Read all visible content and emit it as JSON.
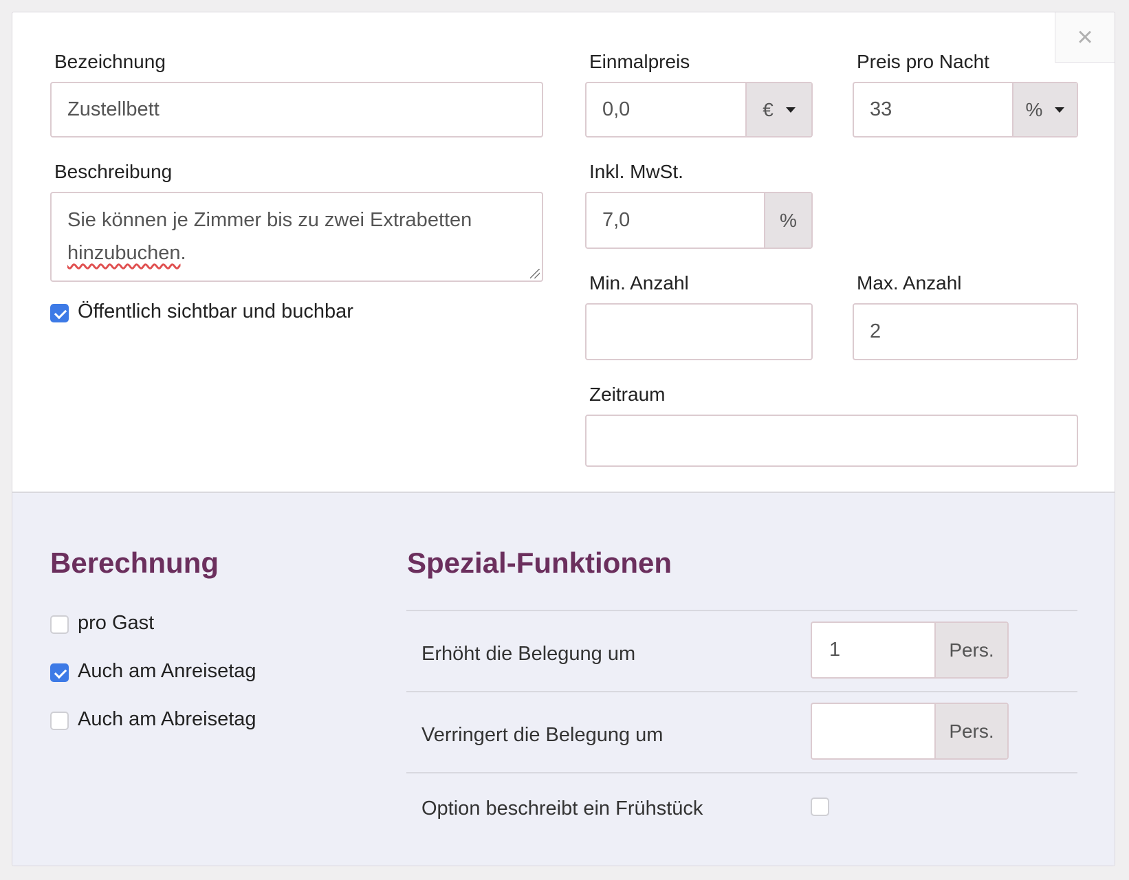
{
  "close": {
    "glyph": "×"
  },
  "form": {
    "bezeichnung": {
      "label": "Bezeichnung",
      "value": "Zustellbett"
    },
    "beschreibung": {
      "label": "Beschreibung",
      "line1": "Sie können je Zimmer bis zu zwei Extrabetten",
      "line2_word": "hinzubuchen",
      "line2_punct": "."
    },
    "public": {
      "label": "Öffentlich sichtbar und buchbar",
      "checked": true
    },
    "einmalpreis": {
      "label": "Einmalpreis",
      "value": "0,0",
      "unit": "€"
    },
    "preis_pro_nacht": {
      "label": "Preis pro Nacht",
      "value": "33",
      "unit": "%"
    },
    "mwst": {
      "label": "Inkl. MwSt.",
      "value": "7,0",
      "unit": "%"
    },
    "min_anzahl": {
      "label": "Min. Anzahl",
      "value": ""
    },
    "max_anzahl": {
      "label": "Max. Anzahl",
      "value": "2"
    },
    "zeitraum": {
      "label": "Zeitraum",
      "value": ""
    }
  },
  "berechnung": {
    "title": "Berechnung",
    "options": [
      {
        "label": "pro Gast",
        "checked": false
      },
      {
        "label": "Auch am Anreisetag",
        "checked": true
      },
      {
        "label": "Auch am Abreisetag",
        "checked": false
      }
    ]
  },
  "spezial": {
    "title": "Spezial-Funktionen",
    "erhoeht": {
      "label": "Erhöht die Belegung um",
      "value": "1",
      "unit": "Pers."
    },
    "verringert": {
      "label": "Verringert die Belegung um",
      "value": "",
      "unit": "Pers."
    },
    "fruehstueck": {
      "label": "Option beschreibt ein Frühstück",
      "checked": false
    }
  }
}
